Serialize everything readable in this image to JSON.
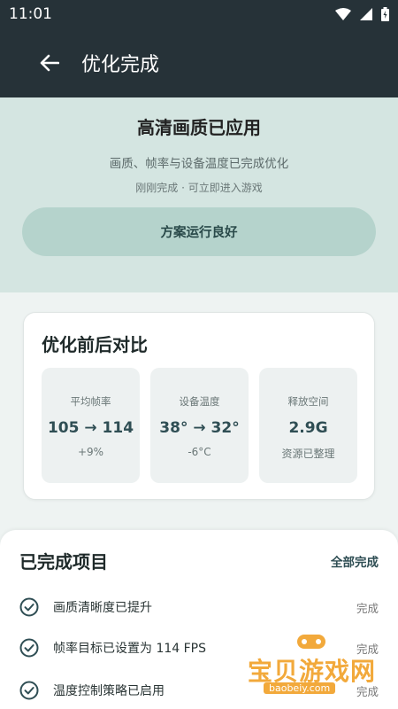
{
  "status_bar": {
    "time": "11:01",
    "icons": [
      "wifi-icon",
      "signal-icon",
      "battery-icon"
    ]
  },
  "app_bar": {
    "title": "优化完成",
    "back_icon": "arrow-left-icon"
  },
  "hero": {
    "title": "高清画质已应用",
    "subtitle": "画质、帧率与设备温度已完成优化",
    "note": "刚刚完成 · 可立即进入游戏",
    "status_button": "方案运行良好"
  },
  "comparison": {
    "title": "优化前后对比",
    "metrics": [
      {
        "label": "平均帧率",
        "value": "105 → 114",
        "change": "+9%"
      },
      {
        "label": "设备温度",
        "value": "38° → 32°",
        "change": "-6°C"
      },
      {
        "label": "释放空间",
        "value": "2.9G",
        "change": "资源已整理"
      }
    ]
  },
  "completed": {
    "title": "已完成项目",
    "all_done_label": "全部完成",
    "items": [
      {
        "label": "画质清晰度已提升",
        "state": "完成"
      },
      {
        "label": "帧率目标已设置为 114 FPS",
        "state": "完成"
      },
      {
        "label": "温度控制策略已启用",
        "state": "完成"
      }
    ]
  },
  "watermark": {
    "text": "宝贝游戏网",
    "url": "baobeiy.com"
  },
  "colors": {
    "header": "#263238",
    "hero_bg": "#d4e5e1",
    "pill": "#b5d3cc",
    "accent": "#2f4e54"
  }
}
